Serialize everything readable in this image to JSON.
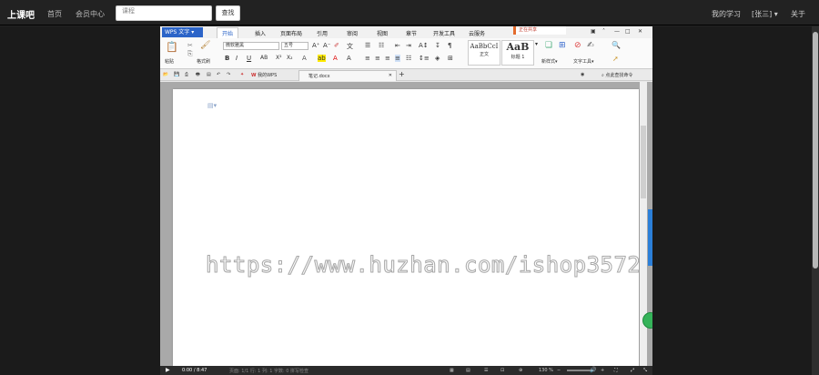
{
  "site": {
    "brand": "上课吧",
    "nav": [
      "首页",
      "会员中心"
    ],
    "search": {
      "placeholder": "课程",
      "button": "查找"
    },
    "right_nav": [
      "我的学习",
      "[张三]",
      "关于"
    ]
  },
  "wps": {
    "app_name": "WPS 文字",
    "tabs": [
      "开始",
      "插入",
      "页面布局",
      "引用",
      "审阅",
      "视图",
      "章节",
      "开发工具",
      "云服务"
    ],
    "active_tab": "开始",
    "share_label": "正在共享",
    "ribbon": {
      "paste": "粘贴",
      "format_painter": "格式刷",
      "font_name": "微软雅黑",
      "font_size": "五号",
      "styles": [
        {
          "sample": "AaBbCcI",
          "caption": "正文"
        },
        {
          "sample": "AaB",
          "caption": "标题 1"
        }
      ],
      "new_style": "新样式",
      "text_tools": "文字工具",
      "find": "查找"
    },
    "doc_tabs": {
      "home": "我的WPS",
      "active": "笔记.docx",
      "search_hint": "点此查找命令"
    }
  },
  "player": {
    "time": "0:00 / 8:47",
    "status_text": "页面: 1/1  行: 1  列: 1  字数: 0  拼写检查",
    "zoom": "130 %"
  },
  "watermark": "https://www.huzhan.com/ishop3572"
}
